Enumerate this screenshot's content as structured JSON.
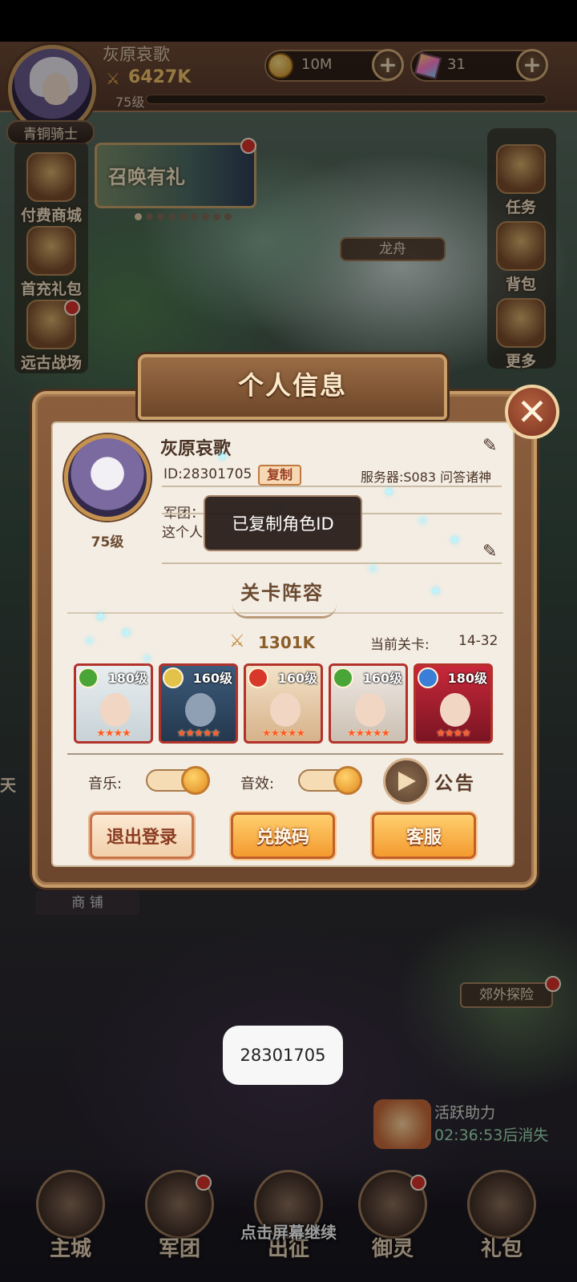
{
  "hud": {
    "player_name": "灰原哀歌",
    "power": "6427K",
    "level": "75级",
    "rank": "青铜骑士",
    "gold": "10M",
    "gems": "31"
  },
  "left_menu": [
    {
      "label": "付费商城"
    },
    {
      "label": "首充礼包"
    },
    {
      "label": "远古战场"
    }
  ],
  "right_menu": [
    {
      "label": "任务"
    },
    {
      "label": "背包"
    },
    {
      "label": "更多"
    }
  ],
  "summon_banner": "召唤有礼",
  "map_labels": {
    "dragon_boat": "龙舟",
    "shop": "商 铺",
    "adventure": "郊外探险",
    "tianxia": "天"
  },
  "dialog": {
    "title": "个人信息",
    "name": "灰原哀歌",
    "player_level": "75级",
    "id": "ID:28301705",
    "copy_label": "复制",
    "server": "服务器:S083 问答诸神",
    "guild": "军团：",
    "signature": "这个人",
    "lineup_title": "关卡阵容",
    "lineup_power": "1301K",
    "stage_label": "当前关卡:",
    "stage_value": "14-32",
    "heroes": [
      {
        "level": "180级",
        "stars": "★★★★",
        "element": "wind"
      },
      {
        "level": "160级",
        "stars": "★★★★★",
        "element": "light"
      },
      {
        "level": "160级",
        "stars": "★★★★★",
        "element": "fire"
      },
      {
        "level": "160级",
        "stars": "★★★★★",
        "element": "wind"
      },
      {
        "level": "180级",
        "stars": "★★★★",
        "element": "water"
      }
    ],
    "music_label": "音乐:",
    "sfx_label": "音效:",
    "notice_label": "公告",
    "logout_label": "退出登录",
    "redeem_label": "兑换码",
    "service_label": "客服"
  },
  "toast_copied": "已复制角色ID",
  "clipboard_toast": "28301705",
  "activity": {
    "title": "活跃助力",
    "timer": "02:36:53后消失"
  },
  "bottom_nav": [
    {
      "label": "主城"
    },
    {
      "label": "军团"
    },
    {
      "label": "出征"
    },
    {
      "label": "御灵"
    },
    {
      "label": "礼包"
    }
  ],
  "continue_hint": "点击屏幕继续",
  "colors": {
    "accent_orange": "#f39a2e",
    "frame_brown": "#6b462d",
    "panel_cream": "#f3ede4",
    "hero_border_red": "#b2322a"
  }
}
